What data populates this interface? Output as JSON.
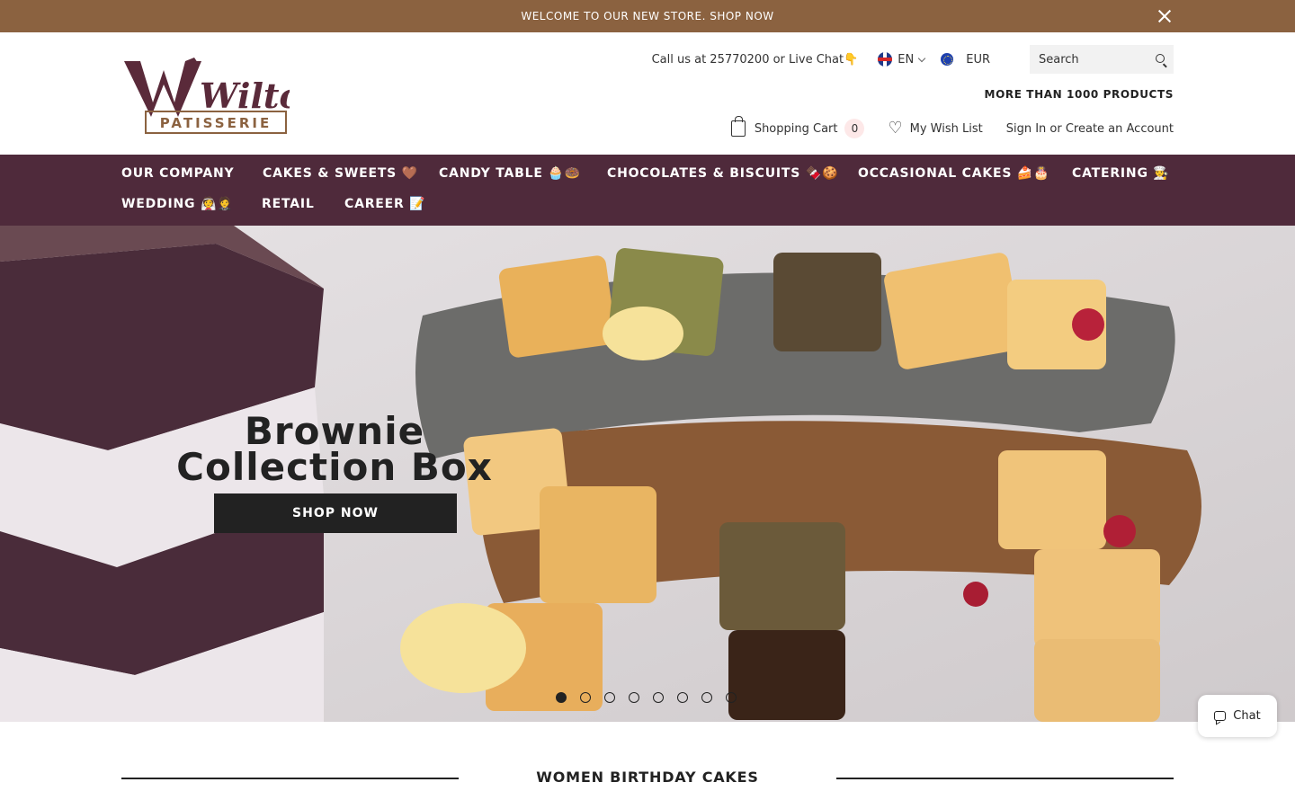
{
  "announcement": {
    "text": "WELCOME TO OUR NEW STORE. SHOP NOW"
  },
  "brand": {
    "logo_word": "Wilton",
    "logo_sub": "PATISSERIE"
  },
  "header": {
    "call_text": "Call us at 25770200 or Live Chat👇",
    "language": "EN",
    "currency": "EUR",
    "search_placeholder": "Search",
    "tagline": "MORE THAN 1000 PRODUCTS",
    "cart_label": "Shopping Cart",
    "cart_count": "0",
    "wishlist_label": "My Wish List",
    "account_label": "Sign In or Create an Account"
  },
  "nav": {
    "items": [
      {
        "label": "OUR COMPANY"
      },
      {
        "label": "CAKES & SWEETS 🤎"
      },
      {
        "label": "CANDY TABLE 🧁🍩"
      },
      {
        "label": "CHOCOLATES & BISCUITS 🍫🍪"
      },
      {
        "label": "OCCASIONAL CAKES 🍰🎂"
      },
      {
        "label": "CATERING 👨‍🍳"
      },
      {
        "label": "WEDDING 👰🤵"
      },
      {
        "label": "RETAIL"
      },
      {
        "label": "CAREER 📝"
      }
    ]
  },
  "hero": {
    "title": "Brownie Collection Box",
    "button": "SHOP NOW",
    "slide_count": 8,
    "active_slide": 1
  },
  "chat": {
    "label": "Chat"
  },
  "section": {
    "title": "WOMEN BIRTHDAY CAKES"
  },
  "colors": {
    "announce": "#8b6240",
    "nav": "#4f2a3b",
    "brand": "#5a2a3a"
  }
}
